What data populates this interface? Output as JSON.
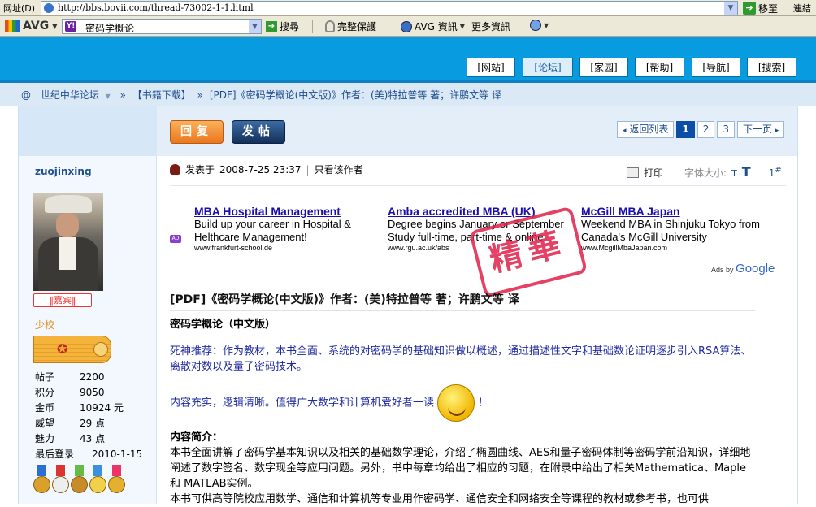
{
  "browser": {
    "address_label": "网址(D)",
    "url": "http://bbs.bovii.com/thread-73002-1-1.html",
    "go_label": "移至",
    "links_label": "連結"
  },
  "toolbar": {
    "avg_label": "AVG",
    "search_text": "密码学概论",
    "search_button": "搜尋",
    "protect_label": "完整保護",
    "avg_news_label": "AVG 資訊",
    "more_news_label": "更多資訊"
  },
  "nav": {
    "tabs": [
      "[网站]",
      "[论坛]",
      "[家园]",
      "[帮助]",
      "[导航]",
      "[搜索]"
    ],
    "active_index": 1
  },
  "breadcrumb": {
    "home_symbol": "@",
    "items": [
      "世纪中华论坛",
      "【书籍下载】",
      "[PDF]《密码学概论(中文版)》作者：(美)特拉普等 著；许鹏文等 译"
    ]
  },
  "actions": {
    "reply_label": "回复",
    "post_label": "发帖"
  },
  "pager": {
    "back_label": "返回列表",
    "pages": [
      "1",
      "2",
      "3"
    ],
    "current_page": "1",
    "next_label": "下一页"
  },
  "user": {
    "name": "zuojinxing",
    "badge": "‖嘉宾‖",
    "rank_title": "少校",
    "stats": [
      {
        "k": "帖子",
        "v": "2200"
      },
      {
        "k": "积分",
        "v": "9050"
      },
      {
        "k": "金币",
        "v": "10924 元"
      },
      {
        "k": "威望",
        "v": "29 点"
      },
      {
        "k": "魅力",
        "v": "43 点"
      },
      {
        "k": "最后登录",
        "v": "2010-1-15"
      }
    ]
  },
  "post": {
    "posted_prefix": "发表于",
    "posted_at": "2008-7-25 23:37",
    "only_author": "只看该作者",
    "print_label": "打印",
    "font_size_label": "字体大小:",
    "font_small": "T",
    "font_big": "T",
    "floor": "1",
    "floor_suffix": "#",
    "title": "[PDF]《密码学概论(中文版)》作者：(美)特拉普等 著；许鹏文等 译",
    "subtitle": "密码学概论（中文版）",
    "recommend": "死神推荐：作为教材，本书全面、系统的对密码学的基础知识做以概述，通过描述性文字和基础数论证明逐步引入RSA算法、离散对数以及量子密码技术。",
    "praise_before": "内容充实，逻辑清晰。值得广大数学和计算机爱好者一读",
    "praise_after": "！",
    "intro_heading": "内容简介：",
    "intro_text": "本书全面讲解了密码学基本知识以及相关的基础数学理论，介绍了椭圆曲线、AES和量子密码体制等密码学前沿知识，详细地阐述了数字签名、数字现金等应用问题。另外，书中每章均给出了相应的习题，在附录中给出了相关Mathematica、Maple和 MATLAB实例。",
    "intro_text_2": "本书可供高等院校应用数学、通信和计算机等专业用作密码学、通信安全和网络安全等课程的教材或参考书，也可供"
  },
  "ads": {
    "items": [
      {
        "title": "MBA Hospital Management",
        "desc": "Build up your career in Hospital & Helthcare Management!",
        "url": "www.frankfurt-school.de"
      },
      {
        "title": "Amba accredited MBA (UK)",
        "desc": "Degree begins January or September Study full-time, part-time & online",
        "url": "www.rgu.ac.uk/abs"
      },
      {
        "title": "McGill MBA Japan",
        "desc": "Weekend MBA in Shinjuku Tokyo from Canada's McGill University",
        "url": "www.McgillMbaJapan.com"
      }
    ],
    "ads_by": "Ads by",
    "google": "Google",
    "ad_icon": "AD"
  },
  "stamp_text": "精華",
  "colors": {
    "header_blue": "#089be0",
    "link_blue": "#1f4e8c",
    "stamp_red": "#e0204a"
  }
}
